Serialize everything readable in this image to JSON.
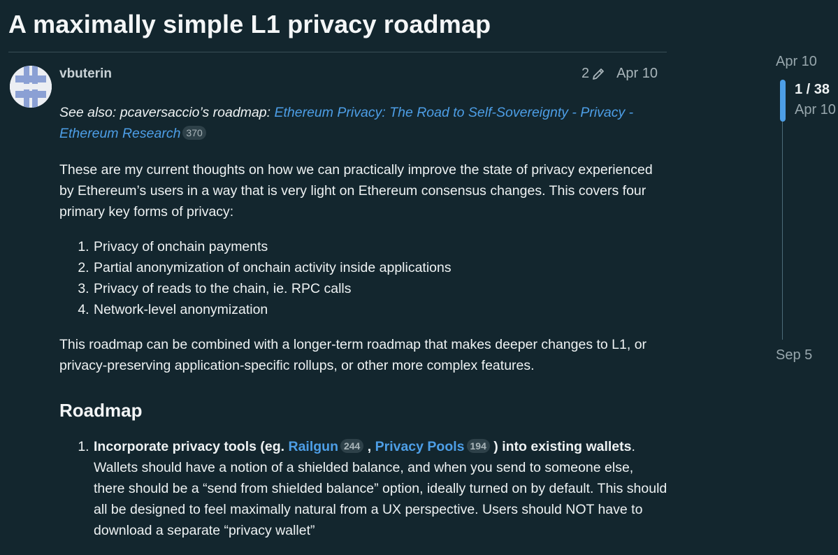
{
  "topic": {
    "title": "A maximally simple L1 privacy roadmap"
  },
  "post": {
    "author": "vbuterin",
    "edit_count": "2",
    "date": "Apr 10",
    "see_also_prefix": "See also: pcaversaccio’s roadmap: ",
    "see_also_link": "Ethereum Privacy: The Road to Self-Sovereignty - Privacy - Ethereum Research",
    "see_also_clicks": "370",
    "intro": "These are my current thoughts on how we can practically improve the state of privacy experienced by Ethereum’s users in a way that is very light on Ethereum consensus changes. This covers four primary key forms of privacy:",
    "forms": [
      "Privacy of onchain payments",
      "Partial anonymization of onchain activity inside applications",
      "Privacy of reads to the chain, ie. RPC calls",
      "Network-level anonymization"
    ],
    "combine": "This roadmap can be combined with a longer-term roadmap that makes deeper changes to L1, or privacy-preserving application-specific rollups, or other more complex features.",
    "roadmap_heading": "Roadmap",
    "step1": {
      "bold_prefix": "Incorporate privacy tools (eg. ",
      "link1": "Railgun",
      "link1_clicks": "244",
      "sep": " , ",
      "link2": "Privacy Pools",
      "link2_clicks": "194",
      "bold_suffix": " ) into existing wallets",
      "period": ".",
      "body": " Wallets should have a notion of a shielded balance, and when you send to someone else, there should be a “send from shielded balance” option, ideally turned on by default. This should all be designed to feel maximally natural from a UX perspective. Users should NOT have to download a separate “privacy wallet”"
    }
  },
  "timeline": {
    "start_date": "Apr 10",
    "position": "1 / 38",
    "current_date": "Apr 10",
    "end_date": "Sep 5"
  }
}
